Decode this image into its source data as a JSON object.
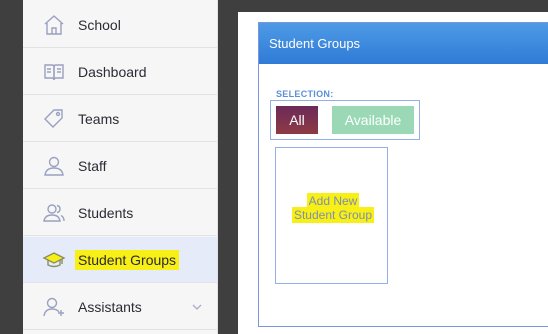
{
  "sidebar": {
    "items": [
      {
        "label": "School",
        "icon": "home-icon"
      },
      {
        "label": "Dashboard",
        "icon": "book-icon"
      },
      {
        "label": "Teams",
        "icon": "tag-icon"
      },
      {
        "label": "Staff",
        "icon": "user-icon"
      },
      {
        "label": "Students",
        "icon": "users-icon"
      },
      {
        "label": "Student Groups",
        "icon": "graduation-cap-icon",
        "active": true
      },
      {
        "label": "Assistants",
        "icon": "user-plus-icon"
      }
    ]
  },
  "panel": {
    "title": "Student Groups",
    "selection_label": "SELECTION:",
    "buttons": {
      "all": "All",
      "available": "Available"
    },
    "add_card": {
      "line1": "Add New",
      "line2": "Student Group"
    }
  },
  "colors": {
    "header": "#3a88dd",
    "highlight": "#f7ef16",
    "all_button": "#7a3150",
    "available_button": "#9ad8b6",
    "active_row": "#e6ebf9"
  }
}
